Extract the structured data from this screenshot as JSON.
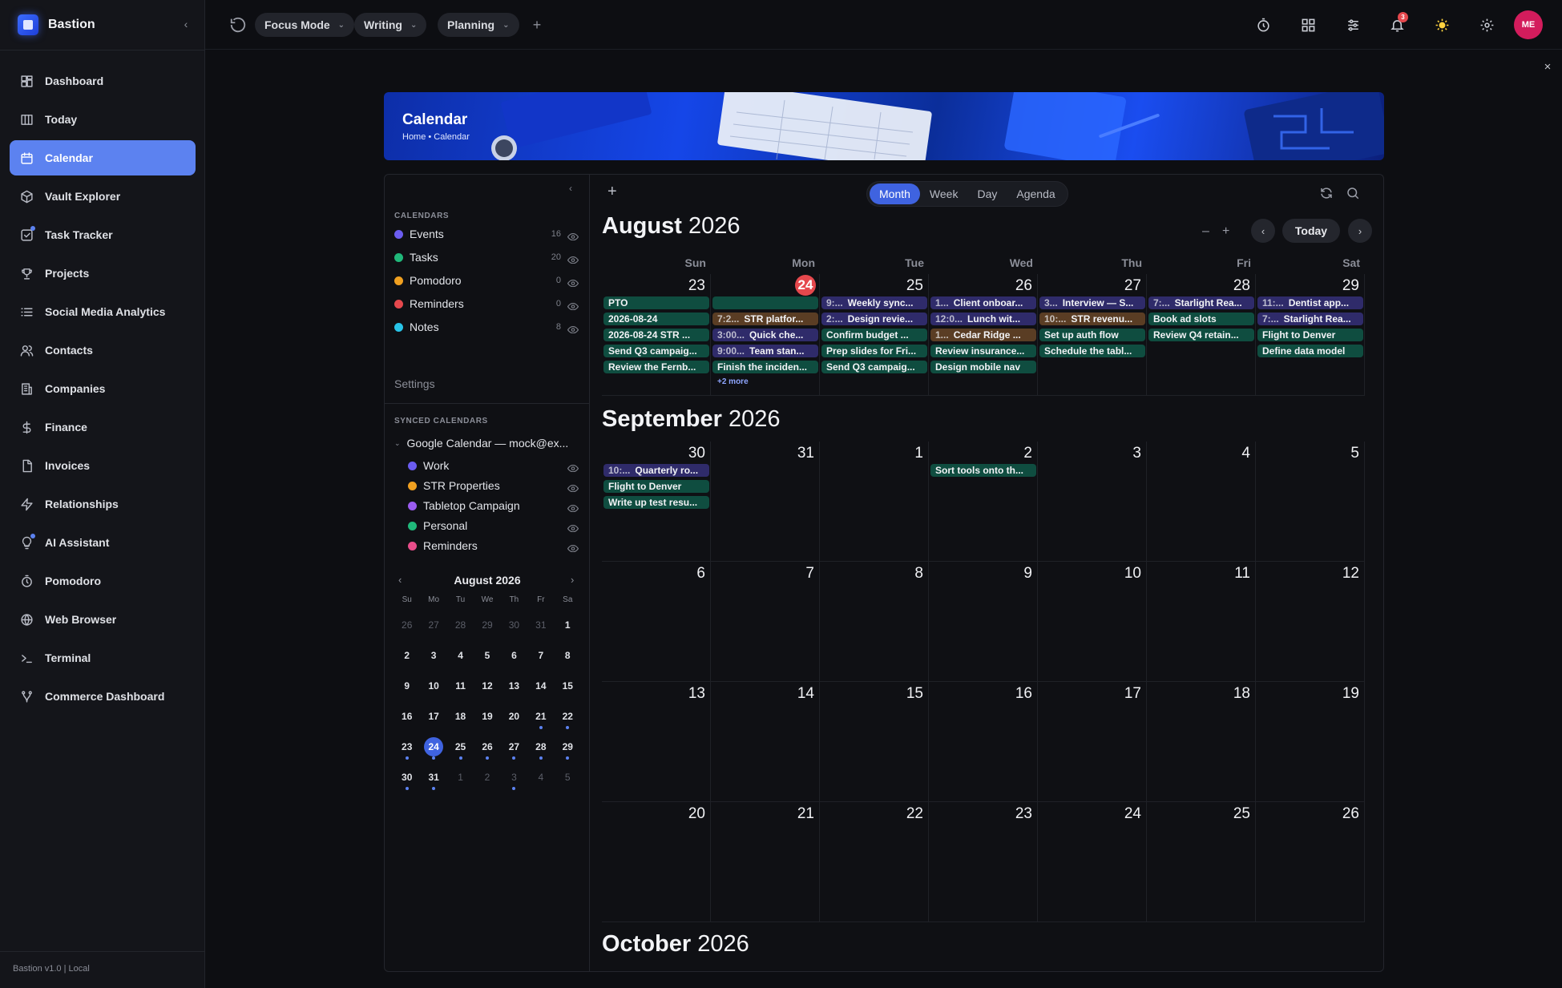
{
  "app": {
    "name": "Bastion",
    "footer": "Bastion v1.0 | Local"
  },
  "nav": [
    {
      "label": "Dashboard",
      "icon": "dashboard-icon"
    },
    {
      "label": "Today",
      "icon": "columns-icon"
    },
    {
      "label": "Calendar",
      "icon": "calendar-icon",
      "active": true
    },
    {
      "label": "Vault Explorer",
      "icon": "cube-icon"
    },
    {
      "label": "Task Tracker",
      "icon": "checkbox-icon"
    },
    {
      "label": "Projects",
      "icon": "trophy-icon"
    },
    {
      "label": "Social Media Analytics",
      "icon": "list-icon"
    },
    {
      "label": "Contacts",
      "icon": "users-icon"
    },
    {
      "label": "Companies",
      "icon": "building-icon"
    },
    {
      "label": "Finance",
      "icon": "dollar-icon"
    },
    {
      "label": "Invoices",
      "icon": "file-icon"
    },
    {
      "label": "Relationships",
      "icon": "bolt-icon"
    },
    {
      "label": "AI Assistant",
      "icon": "bulb-icon"
    },
    {
      "label": "Pomodoro",
      "icon": "timer-icon"
    },
    {
      "label": "Web Browser",
      "icon": "globe-icon"
    },
    {
      "label": "Terminal",
      "icon": "terminal-icon"
    },
    {
      "label": "Commerce Dashboard",
      "icon": "branch-icon"
    }
  ],
  "topbar": {
    "tabs": [
      "Focus Mode",
      "Writing",
      "Planning"
    ],
    "notification_count": "3",
    "avatar": "ME"
  },
  "banner": {
    "title": "Calendar",
    "breadcrumb": "Home • Calendar"
  },
  "calendars": {
    "section_title": "CALENDARS",
    "items": [
      {
        "label": "Events",
        "count": "16",
        "color": "#6b5cf0"
      },
      {
        "label": "Tasks",
        "count": "20",
        "color": "#20b87a"
      },
      {
        "label": "Pomodoro",
        "count": "0",
        "color": "#f0a020"
      },
      {
        "label": "Reminders",
        "count": "0",
        "color": "#e5484d"
      },
      {
        "label": "Notes",
        "count": "8",
        "color": "#28c4e8"
      }
    ],
    "settings": "Settings"
  },
  "synced": {
    "section_title": "SYNCED CALENDARS",
    "account": "Google Calendar — mock@ex...",
    "items": [
      {
        "label": "Work",
        "color": "#6b5cf0"
      },
      {
        "label": "STR Properties",
        "color": "#f0a020"
      },
      {
        "label": "Tabletop Campaign",
        "color": "#9b5cf0"
      },
      {
        "label": "Personal",
        "color": "#20b87a"
      },
      {
        "label": "Reminders",
        "color": "#e84d8a"
      }
    ]
  },
  "mini_calendar": {
    "title": "August 2026",
    "dow": [
      "Su",
      "Mo",
      "Tu",
      "We",
      "Th",
      "Fr",
      "Sa"
    ],
    "weeks": [
      [
        [
          "26",
          0,
          0
        ],
        [
          "27",
          0,
          0
        ],
        [
          "28",
          0,
          0
        ],
        [
          "29",
          0,
          0
        ],
        [
          "30",
          0,
          0
        ],
        [
          "31",
          0,
          0
        ],
        [
          "1",
          1,
          0
        ]
      ],
      [
        [
          "2",
          1,
          0
        ],
        [
          "3",
          1,
          0
        ],
        [
          "4",
          1,
          0
        ],
        [
          "5",
          1,
          0
        ],
        [
          "6",
          1,
          0
        ],
        [
          "7",
          1,
          0
        ],
        [
          "8",
          1,
          0
        ]
      ],
      [
        [
          "9",
          1,
          0
        ],
        [
          "10",
          1,
          0
        ],
        [
          "11",
          1,
          0
        ],
        [
          "12",
          1,
          0
        ],
        [
          "13",
          1,
          0
        ],
        [
          "14",
          1,
          0
        ],
        [
          "15",
          1,
          0
        ]
      ],
      [
        [
          "16",
          1,
          0
        ],
        [
          "17",
          1,
          0
        ],
        [
          "18",
          1,
          0
        ],
        [
          "19",
          1,
          0
        ],
        [
          "20",
          1,
          0
        ],
        [
          "21",
          1,
          1
        ],
        [
          "22",
          1,
          1
        ]
      ],
      [
        [
          "23",
          1,
          1
        ],
        [
          "24",
          1,
          1
        ],
        [
          "25",
          1,
          1
        ],
        [
          "26",
          1,
          1
        ],
        [
          "27",
          1,
          1
        ],
        [
          "28",
          1,
          1
        ],
        [
          "29",
          1,
          1
        ]
      ],
      [
        [
          "30",
          1,
          1
        ],
        [
          "31",
          1,
          1
        ],
        [
          "1",
          0,
          0
        ],
        [
          "2",
          0,
          0
        ],
        [
          "3",
          0,
          1
        ],
        [
          "4",
          0,
          0
        ],
        [
          "5",
          0,
          0
        ]
      ]
    ],
    "today": "24"
  },
  "view": {
    "options": [
      "Month",
      "Week",
      "Day",
      "Agenda"
    ],
    "active": "Month",
    "today_label": "Today"
  },
  "dow_headers": [
    "Sun",
    "Mon",
    "Tue",
    "Wed",
    "Thu",
    "Fri",
    "Sat"
  ],
  "months": [
    {
      "month": "August",
      "year": "2026",
      "weeks": [
        [
          {
            "d": "23",
            "events": [
              {
                "t": "",
                "text": "PTO",
                "c": "green"
              },
              {
                "t": "",
                "text": "2026-08-24",
                "c": "green"
              },
              {
                "t": "",
                "text": "2026-08-24 STR ...",
                "c": "green"
              },
              {
                "t": "",
                "text": "Send Q3 campaig...",
                "c": "green"
              },
              {
                "t": "",
                "text": "Review the Fernb...",
                "c": "green"
              }
            ]
          },
          {
            "d": "24",
            "today": true,
            "events": [
              {
                "t": "",
                "text": "",
                "c": "green"
              },
              {
                "t": "7:2...",
                "text": "STR platfor...",
                "c": "orange"
              },
              {
                "t": "3:00...",
                "text": "Quick che...",
                "c": "purple"
              },
              {
                "t": "9:00...",
                "text": "Team stan...",
                "c": "purple"
              },
              {
                "t": "",
                "text": "Finish the inciden...",
                "c": "green"
              }
            ],
            "more": "+2 more"
          },
          {
            "d": "25",
            "events": [
              {
                "t": "9:...",
                "text": "Weekly sync...",
                "c": "purple"
              },
              {
                "t": "2:...",
                "text": "Design revie...",
                "c": "purple"
              },
              {
                "t": "",
                "text": "Confirm budget ...",
                "c": "green"
              },
              {
                "t": "",
                "text": "Prep slides for Fri...",
                "c": "green"
              },
              {
                "t": "",
                "text": "Send Q3 campaig...",
                "c": "green"
              }
            ]
          },
          {
            "d": "26",
            "events": [
              {
                "t": "1...",
                "text": "Client onboar...",
                "c": "purple"
              },
              {
                "t": "12:0...",
                "text": "Lunch wit...",
                "c": "purple"
              },
              {
                "t": "1...",
                "text": "Cedar Ridge ...",
                "c": "orange"
              },
              {
                "t": "",
                "text": "Review insurance...",
                "c": "green"
              },
              {
                "t": "",
                "text": "Design mobile nav",
                "c": "green"
              }
            ]
          },
          {
            "d": "27",
            "events": [
              {
                "t": "3...",
                "text": "Interview — S...",
                "c": "purple"
              },
              {
                "t": "10:...",
                "text": "STR revenu...",
                "c": "orange"
              },
              {
                "t": "",
                "text": "Set up auth flow",
                "c": "green"
              },
              {
                "t": "",
                "text": "Schedule the tabl...",
                "c": "green"
              }
            ]
          },
          {
            "d": "28",
            "events": [
              {
                "t": "7:...",
                "text": "Starlight Rea...",
                "c": "purple"
              },
              {
                "t": "",
                "text": "Book ad slots",
                "c": "green"
              },
              {
                "t": "",
                "text": "Review Q4 retain...",
                "c": "green"
              }
            ]
          },
          {
            "d": "29",
            "events": [
              {
                "t": "11:...",
                "text": "Dentist app...",
                "c": "purple"
              },
              {
                "t": "7:...",
                "text": "Starlight Rea...",
                "c": "purple"
              },
              {
                "t": "",
                "text": "Flight to Denver",
                "c": "green"
              },
              {
                "t": "",
                "text": "Define data model",
                "c": "green"
              }
            ]
          }
        ]
      ]
    },
    {
      "month": "September",
      "year": "2026",
      "weeks": [
        [
          {
            "d": "30",
            "events": [
              {
                "t": "10:...",
                "text": "Quarterly ro...",
                "c": "purple"
              },
              {
                "t": "",
                "text": "Flight to Denver",
                "c": "green"
              },
              {
                "t": "",
                "text": "Write up test resu...",
                "c": "green"
              }
            ]
          },
          {
            "d": "31",
            "events": []
          },
          {
            "d": "1",
            "events": []
          },
          {
            "d": "2",
            "events": [
              {
                "t": "",
                "text": "Sort tools onto th...",
                "c": "green"
              }
            ]
          },
          {
            "d": "3",
            "events": []
          },
          {
            "d": "4",
            "events": []
          },
          {
            "d": "5",
            "events": []
          }
        ],
        [
          {
            "d": "6",
            "events": []
          },
          {
            "d": "7",
            "events": []
          },
          {
            "d": "8",
            "events": []
          },
          {
            "d": "9",
            "events": []
          },
          {
            "d": "10",
            "events": []
          },
          {
            "d": "11",
            "events": []
          },
          {
            "d": "12",
            "events": []
          }
        ],
        [
          {
            "d": "13",
            "events": []
          },
          {
            "d": "14",
            "events": []
          },
          {
            "d": "15",
            "events": []
          },
          {
            "d": "16",
            "events": []
          },
          {
            "d": "17",
            "events": []
          },
          {
            "d": "18",
            "events": []
          },
          {
            "d": "19",
            "events": []
          }
        ],
        [
          {
            "d": "20",
            "events": []
          },
          {
            "d": "21",
            "events": []
          },
          {
            "d": "22",
            "events": []
          },
          {
            "d": "23",
            "events": []
          },
          {
            "d": "24",
            "events": []
          },
          {
            "d": "25",
            "events": []
          },
          {
            "d": "26",
            "events": []
          }
        ]
      ]
    },
    {
      "month": "October",
      "year": "2026",
      "weeks": []
    }
  ]
}
